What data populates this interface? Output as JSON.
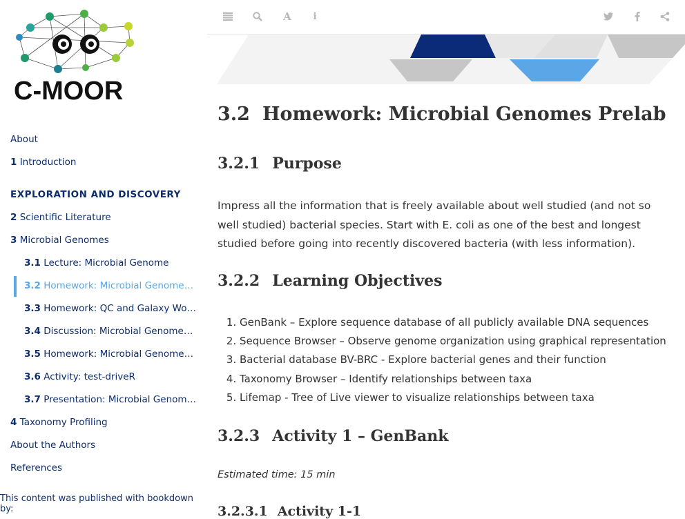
{
  "logo": {
    "text": "C-MOOR"
  },
  "sidebar": {
    "items": [
      {
        "num": "",
        "label": "About",
        "level": 1
      },
      {
        "num": "1",
        "label": "Introduction",
        "level": 1
      },
      {
        "num": "",
        "label": "EXPLORATION AND DISCOVERY",
        "level": 0
      },
      {
        "num": "2",
        "label": "Scientific Literature",
        "level": 1
      },
      {
        "num": "3",
        "label": "Microbial Genomes",
        "level": 1
      },
      {
        "num": "3.1",
        "label": "Lecture: Microbial Genome",
        "level": 2
      },
      {
        "num": "3.2",
        "label": "Homework: Microbial Genomes Pr...",
        "level": 2,
        "active": true
      },
      {
        "num": "3.3",
        "label": "Homework: QC and Galaxy Workfl...",
        "level": 2
      },
      {
        "num": "3.4",
        "label": "Discussion: Microbial Genomes P...",
        "level": 2
      },
      {
        "num": "3.5",
        "label": "Homework: Microbial Genomes Pr...",
        "level": 2
      },
      {
        "num": "3.6",
        "label": "Activity: test-driveR",
        "level": 2
      },
      {
        "num": "3.7",
        "label": "Presentation: Microbial Genomes ...",
        "level": 2
      },
      {
        "num": "4",
        "label": "Taxonomy Profiling",
        "level": 1
      },
      {
        "num": "",
        "label": "About the Authors",
        "level": 1
      },
      {
        "num": "",
        "label": "References",
        "level": 1
      }
    ],
    "published": "This content was published with bookdown by:"
  },
  "toolbar": {
    "icons": [
      "menu-icon",
      "search-icon",
      "font-icon",
      "info-icon",
      "twitter-icon",
      "facebook-icon",
      "share-icon"
    ]
  },
  "colors": {
    "accent": "#5aa6e6",
    "link": "#0d2d6b",
    "navy": "#0b2a78"
  },
  "content": {
    "title_num": "3.2",
    "title": "Homework: Microbial Genomes Prelab",
    "purpose_num": "3.2.1",
    "purpose_heading": "Purpose",
    "purpose_text": "Impress all the information that is freely available about well studied (and not so well studied) bacterial species. Start with E. coli as one of the best and longest studied before going into recently discovered bacteria (with less information).",
    "objectives_num": "3.2.2",
    "objectives_heading": "Learning Objectives",
    "objectives": [
      "GenBank – Explore sequence database of all publicly available DNA sequences",
      "Sequence Browser – Observe genome organization using graphical representation",
      "Bacterial database BV-BRC - Explore bacterial genes and their function",
      "Taxonomy Browser – Identify relationships between taxa",
      "Lifemap - Tree of Live viewer to visualize relationships between taxa"
    ],
    "activity_num": "3.2.3",
    "activity_heading": "Activity 1 – GenBank",
    "estimated_time": "Estimated time: 15 min",
    "sub_num": "3.2.3.1",
    "sub_heading": "Activity 1-1"
  }
}
